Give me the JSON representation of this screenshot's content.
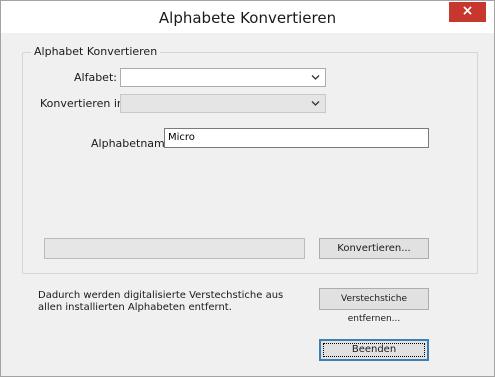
{
  "window": {
    "title": "Alphabete Konvertieren",
    "close_label": "×"
  },
  "group": {
    "label": "Alphabet Konvertieren",
    "alphabet_label": "Alfabet:",
    "alphabet_value": "",
    "convert_to_label": "Konvertieren in:",
    "convert_to_value": "",
    "alphabet_name_label": "Alphabetname:",
    "alphabet_name_value": "Micro",
    "progress": 0,
    "convert_button": "Konvertieren..."
  },
  "footer": {
    "info_text": "Dadurch werden digitalisierte Verstechstiche aus allen installierten Alphabeten entfernt.",
    "remove_button": "Verstechstiche entfernen...",
    "close_button": "Beenden"
  }
}
